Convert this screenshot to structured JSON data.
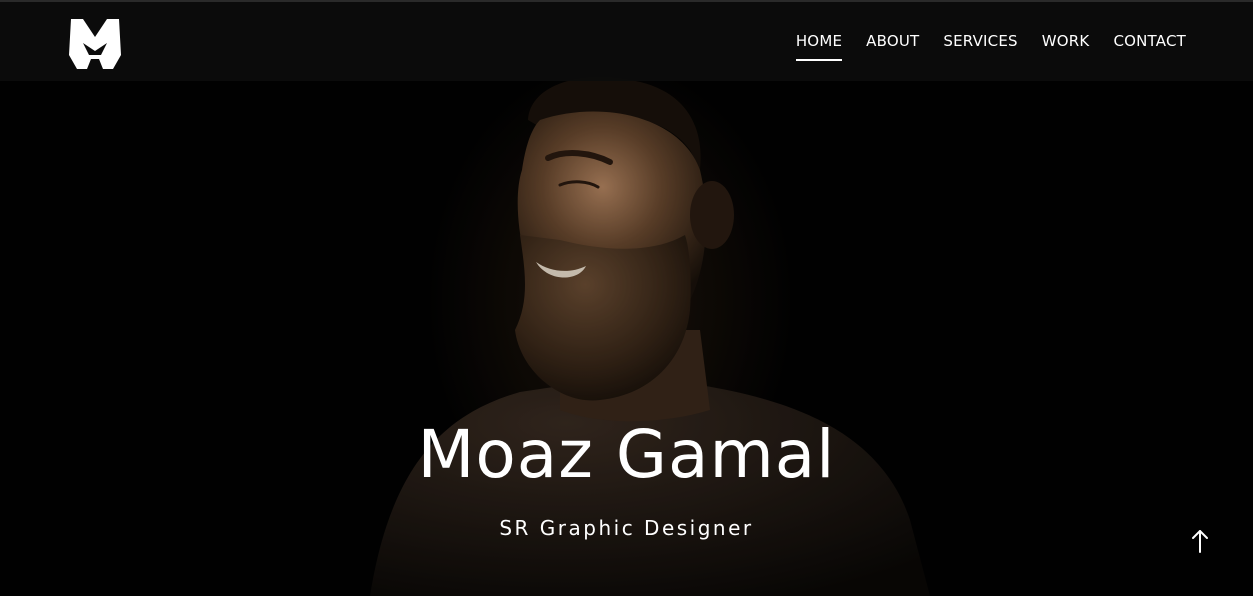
{
  "header": {
    "logo_icon": "m-monogram-logo",
    "nav": [
      {
        "label": "HOME",
        "active": true
      },
      {
        "label": "ABOUT",
        "active": false
      },
      {
        "label": "SERVICES",
        "active": false
      },
      {
        "label": "WORK",
        "active": false
      },
      {
        "label": "CONTACT",
        "active": false
      }
    ]
  },
  "hero": {
    "name": "Moaz Gamal",
    "role": "SR Graphic Designer",
    "background_icon": "portrait-photo"
  },
  "back_to_top": {
    "icon": "arrow-up-icon"
  },
  "colors": {
    "background": "#020202",
    "header": "#0c0c0c",
    "text": "#ffffff"
  }
}
